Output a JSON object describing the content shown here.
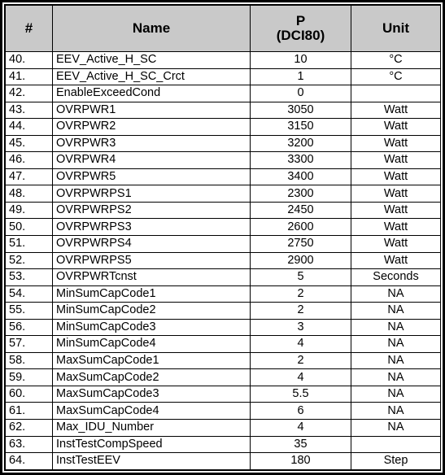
{
  "table": {
    "columns": [
      {
        "key": "num",
        "label": "#"
      },
      {
        "key": "name",
        "label": "Name"
      },
      {
        "key": "p",
        "label_line1": "P",
        "label_line2": "(DCI80)"
      },
      {
        "key": "unit",
        "label": "Unit"
      }
    ],
    "header_background": "#c9c9c9",
    "border_color": "#000000",
    "rows": [
      {
        "num": "40.",
        "name": "EEV_Active_H_SC",
        "p": "10",
        "unit": "°C"
      },
      {
        "num": "41.",
        "name": "EEV_Active_H_SC_Crct",
        "p": "1",
        "unit": "°C"
      },
      {
        "num": "42.",
        "name": "EnableExceedCond",
        "p": "0",
        "unit": ""
      },
      {
        "num": "43.",
        "name": "OVRPWR1",
        "p": "3050",
        "unit": "Watt"
      },
      {
        "num": "44.",
        "name": "OVRPWR2",
        "p": "3150",
        "unit": "Watt"
      },
      {
        "num": "45.",
        "name": "OVRPWR3",
        "p": "3200",
        "unit": "Watt"
      },
      {
        "num": "46.",
        "name": "OVRPWR4",
        "p": "3300",
        "unit": "Watt"
      },
      {
        "num": "47.",
        "name": "OVRPWR5",
        "p": "3400",
        "unit": "Watt"
      },
      {
        "num": "48.",
        "name": "OVRPWRPS1",
        "p": "2300",
        "unit": "Watt"
      },
      {
        "num": "49.",
        "name": "OVRPWRPS2",
        "p": "2450",
        "unit": "Watt"
      },
      {
        "num": "50.",
        "name": "OVRPWRPS3",
        "p": "2600",
        "unit": "Watt"
      },
      {
        "num": "51.",
        "name": "OVRPWRPS4",
        "p": "2750",
        "unit": "Watt"
      },
      {
        "num": "52.",
        "name": "OVRPWRPS5",
        "p": "2900",
        "unit": "Watt"
      },
      {
        "num": "53.",
        "name": "OVRPWRTcnst",
        "p": "5",
        "unit": "Seconds"
      },
      {
        "num": "54.",
        "name": "MinSumCapCode1",
        "p": "2",
        "unit": "NA"
      },
      {
        "num": "55.",
        "name": "MinSumCapCode2",
        "p": "2",
        "unit": "NA"
      },
      {
        "num": "56.",
        "name": "MinSumCapCode3",
        "p": "3",
        "unit": "NA"
      },
      {
        "num": "57.",
        "name": "MinSumCapCode4",
        "p": "4",
        "unit": "NA"
      },
      {
        "num": "58.",
        "name": "MaxSumCapCode1",
        "p": "2",
        "unit": "NA"
      },
      {
        "num": "59.",
        "name": "MaxSumCapCode2",
        "p": "4",
        "unit": "NA"
      },
      {
        "num": "60.",
        "name": "MaxSumCapCode3",
        "p": "5.5",
        "unit": "NA"
      },
      {
        "num": "61.",
        "name": "MaxSumCapCode4",
        "p": "6",
        "unit": "NA"
      },
      {
        "num": "62.",
        "name": "Max_IDU_Number",
        "p": "4",
        "unit": "NA"
      },
      {
        "num": "63.",
        "name": "InstTestCompSpeed",
        "p": "35",
        "unit": ""
      },
      {
        "num": "64.",
        "name": "InstTestEEV",
        "p": "180",
        "unit": "Step"
      }
    ]
  }
}
